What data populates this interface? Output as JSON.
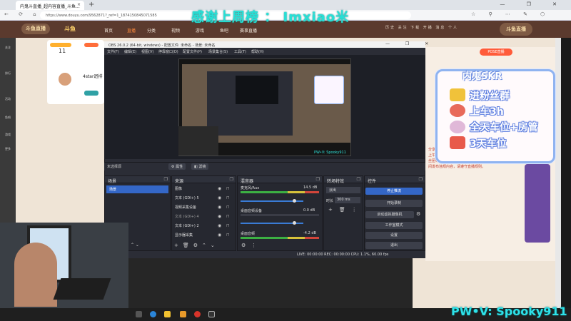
{
  "browser": {
    "tab_title": "内鬼斗直播_超内容直播_斗鱼...",
    "tab_close": "×",
    "new_tab": "+",
    "url": "https://www.douyu.com/9562871?_ref=1_1874150845071585",
    "window_controls": "—  ❐  ✕",
    "nav": "←  ⟳  ⌂",
    "tools": "☆ ⚲ ⋯ ✎ ⬡"
  },
  "site": {
    "logo": "斗鱼直播",
    "logo2": "斗鱼",
    "nav": [
      "首页",
      "直播",
      "分类",
      "视频",
      "游戏",
      "鱼吧",
      "赛事直播"
    ],
    "active_nav": "直播",
    "header_icons": "历史  关注  下载  开播  消息  个人",
    "logo_right": "斗鱼直播",
    "overlay_text": "感谢上周榜  ：  Imxiao米",
    "card_number": "11",
    "card_label": "4star迥排",
    "live_tag": "POSE直播",
    "red_text": "分享直播间，下方链接 | 点击关注直播间，抽取好礼，每天上午十点，晚上八点准时开播，欢迎来玩，关注领好礼，粉丝团等你加入，直播内容健康向上，违规举报，不要在直播间发布违规内容，请遵守直播规则。"
  },
  "sidebar": {
    "items": [
      "关注",
      "排行",
      "活动",
      "鱼吧",
      "游戏",
      "更多"
    ]
  },
  "notice": {
    "title": "内鬼SKR",
    "lines": [
      "进粉丝群",
      "上车3h",
      "全天车位+房管",
      "3天车位"
    ]
  },
  "obs": {
    "title": "OBS 26.0.2 (64-bit, windows) - 配置文件: 未命名 - 场景: 未命名",
    "window_controls": "—  ❐  ✕",
    "menu": [
      "文件(F)",
      "编辑(E)",
      "视图(V)",
      "停靠窗口(D)",
      "配置文件(P)",
      "场景集合(S)",
      "工具(T)",
      "帮助(H)"
    ],
    "preview_caption": "PW•V: Spooky911",
    "no_source": "未选择源",
    "props_btn": "⚙ 属性",
    "filters_btn": "◧ 滤镜",
    "docks": {
      "scenes": "场景",
      "sources": "来源",
      "mixer": "混音器",
      "transitions": "转场特效",
      "controls": "控件"
    },
    "scene_selected": "场景",
    "sources": [
      "图像",
      "文本 (GDI+) 5",
      "视频采集设备",
      "文本 (GDI+) 4",
      "文本 (GDI+) 2",
      "显示器采集"
    ],
    "mixer": [
      {
        "name": "麦克风/Aux",
        "db": "14.5 dB"
      },
      {
        "name": "桌面音频设备",
        "db": "0.0 dB"
      },
      {
        "name": "桌面音频",
        "db": "-4.2 dB"
      }
    ],
    "transition_type": "淡出",
    "duration_label": "时长",
    "duration_value": "300 ms",
    "controls": [
      "停止推流",
      "开始录制",
      "启动虚拟摄像机",
      "工作室模式",
      "设置",
      "退出"
    ],
    "status": "LIVE: 00:00:00   REC: 00:00:00   CPU: 1.1%, 60.00 fps"
  },
  "watermark": "PW•V: Spooky911"
}
